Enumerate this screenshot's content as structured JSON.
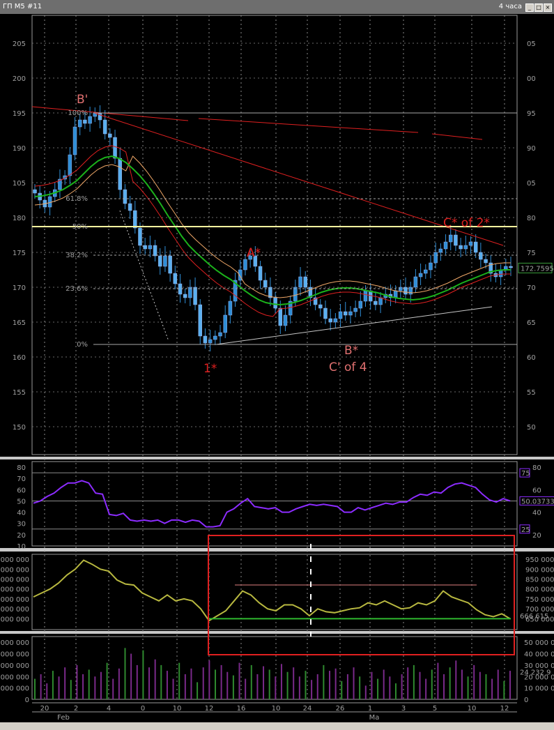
{
  "window": {
    "title": "ГП М5 #11",
    "timeframe": "4 часа",
    "buttons": [
      "_",
      "□",
      "×"
    ]
  },
  "colors": {
    "background": "#000000",
    "up_candle": "#2f8fd8",
    "down_candle": "#2f8fd8",
    "ma_green": "#1bb21b",
    "ma_red": "#e02020",
    "ma_orange": "#f0a868",
    "trendline": "#e02020",
    "fib_50": "#fff8a0",
    "osc_line": "#8c2cff",
    "volume_line": "#b8b840",
    "highlight_box": "#e02020"
  },
  "chart_data": [
    {
      "type": "candlestick",
      "panel": "price",
      "ylim": [
        146,
        209
      ],
      "left_ticks": [
        150,
        155,
        160,
        165,
        170,
        175,
        180,
        185,
        190,
        195,
        200,
        205
      ],
      "left_tick_labels": [
        "150",
        "155",
        "160",
        "165",
        "170",
        "175",
        "180",
        "105",
        "190",
        "195",
        "200",
        "205"
      ],
      "right_ticks": [
        150,
        155,
        160,
        165,
        170,
        175,
        180,
        185,
        190,
        195,
        200,
        205
      ],
      "right_tick_labels": [
        "50",
        "55",
        "60",
        "65",
        "70",
        "75",
        "80",
        "05",
        "90",
        "95",
        "00",
        "05"
      ],
      "last_price_label": "172.7595",
      "x_labels": [
        "20",
        "Feb",
        "2",
        "4",
        "0",
        "10",
        "12",
        "16",
        "10",
        "24",
        "26",
        "1",
        "Ma",
        "3",
        "5",
        "10",
        "12"
      ],
      "closes": [
        183.5,
        182.5,
        181.5,
        183.0,
        184.0,
        185.5,
        186.0,
        189.0,
        193.0,
        194.0,
        193.5,
        194.5,
        195.0,
        194.0,
        192.0,
        191.5,
        188.5,
        184.0,
        182.0,
        181.0,
        178.5,
        176.0,
        175.5,
        176.0,
        174.5,
        173.0,
        174.5,
        172.0,
        170.5,
        169.0,
        168.5,
        170.0,
        167.5,
        163.0,
        162.0,
        162.5,
        163.0,
        163.5,
        166.0,
        168.0,
        171.0,
        172.5,
        174.0,
        174.5,
        173.0,
        171.0,
        170.0,
        168.5,
        167.0,
        164.5,
        166.0,
        168.0,
        170.0,
        171.5,
        170.0,
        168.5,
        167.5,
        167.0,
        165.5,
        165.0,
        165.5,
        166.5,
        166.0,
        166.5,
        167.0,
        168.0,
        169.5,
        168.0,
        167.5,
        168.5,
        169.0,
        168.5,
        169.5,
        170.0,
        169.0,
        170.0,
        171.5,
        172.0,
        172.5,
        173.5,
        175.0,
        175.5,
        176.5,
        177.5,
        176.0,
        175.5,
        176.0,
        176.5,
        175.0,
        174.0,
        173.5,
        172.0,
        171.5,
        172.5,
        173.0,
        172.8
      ],
      "ma_green": [
        183.0,
        183.1,
        183.3,
        183.6,
        184.0,
        184.6,
        185.3,
        186.3,
        187.3,
        188.1,
        188.6,
        188.8,
        188.5,
        187.9,
        187.0,
        186.0,
        184.8,
        183.4,
        181.9,
        180.3,
        178.8,
        177.3,
        176.0,
        175.0,
        174.1,
        173.2,
        172.4,
        171.7,
        171.1,
        170.3,
        169.5,
        168.8,
        168.2,
        167.8,
        167.6,
        167.5,
        167.6,
        167.8,
        168.1,
        168.5,
        168.9,
        169.3,
        169.6,
        169.8,
        169.9,
        169.9,
        169.8,
        169.6,
        169.4,
        169.2,
        168.9,
        168.6,
        168.4,
        168.3,
        168.2,
        168.3,
        168.5,
        168.8,
        169.2,
        169.6,
        170.1,
        170.6,
        171.0,
        171.4,
        171.8,
        172.2,
        172.4,
        172.5,
        172.5
      ],
      "annotations": [
        {
          "text": "B'",
          "color": "#e07070"
        },
        {
          "text": "A*",
          "color": "#e02020"
        },
        {
          "text": "1*",
          "color": "#e02020"
        },
        {
          "text": "B*",
          "color": "#e07070"
        },
        {
          "text": "C' of 4",
          "color": "#e07070"
        },
        {
          "text": "C* of 2*",
          "color": "#e02020"
        }
      ],
      "fib_levels": [
        {
          "label": "100%",
          "value": 195.0
        },
        {
          "label": "61.8%",
          "value": 182.7
        },
        {
          "label": "50%",
          "value": 178.7
        },
        {
          "label": "38.2%",
          "value": 174.6
        },
        {
          "label": "23.6%",
          "value": 169.8
        },
        {
          "label": "0%",
          "value": 161.8
        }
      ]
    },
    {
      "type": "line",
      "panel": "oscillator",
      "ylim": [
        10,
        85
      ],
      "left_ticks": [
        10,
        20,
        30,
        40,
        50,
        60,
        70,
        80
      ],
      "right_tick_labels": [
        "20",
        "40",
        "60",
        "80"
      ],
      "badges": [
        "75",
        "50.03733",
        "25"
      ],
      "values": [
        48,
        50,
        54,
        57,
        62,
        66,
        66,
        68,
        66,
        57,
        56,
        38,
        37,
        39,
        33,
        32,
        33,
        32,
        33,
        30,
        33,
        33,
        31,
        33,
        32,
        27,
        27,
        28,
        40,
        43,
        48,
        52,
        45,
        44,
        43,
        44,
        40,
        40,
        43,
        45,
        47,
        46,
        47,
        46,
        45,
        40,
        40,
        44,
        42,
        44,
        46,
        48,
        47,
        49,
        49,
        53,
        56,
        55,
        58,
        57,
        62,
        65,
        66,
        64,
        62,
        56,
        51,
        49,
        52,
        50
      ]
    },
    {
      "type": "line",
      "panel": "volume_index",
      "ylim": [
        595000,
        975000
      ],
      "left_tick_labels": [
        "000 000",
        "000 000",
        "000 000",
        "000 000",
        "000 000",
        "000 000",
        "000 000"
      ],
      "right_tick_labels": [
        "950 000",
        "900 000",
        "850 000",
        "800 000",
        "750 000",
        "700 000",
        "650 000"
      ],
      "last_value_label": "666 615",
      "values": [
        760,
        780,
        800,
        830,
        870,
        900,
        945,
        925,
        900,
        890,
        845,
        825,
        820,
        780,
        760,
        740,
        770,
        740,
        750,
        740,
        700,
        640,
        665,
        690,
        740,
        790,
        770,
        730,
        700,
        690,
        720,
        720,
        700,
        665,
        700,
        685,
        680,
        690,
        700,
        705,
        730,
        720,
        740,
        720,
        700,
        705,
        730,
        720,
        740,
        790,
        760,
        745,
        730,
        695,
        670,
        660,
        675,
        650
      ],
      "support_value": 650,
      "resistance_value": 820
    },
    {
      "type": "bar",
      "panel": "volume",
      "ylim": [
        0,
        55000
      ],
      "left_tick_labels": [
        "000 000",
        "000 000",
        "000 000",
        "000 000",
        "000 000",
        "0"
      ],
      "right_tick_labels": [
        "50 000 0",
        "40 000 0",
        "30 000 0",
        "20 000 0",
        "10 000 0",
        "0"
      ],
      "last_value_label": "24 232 9",
      "values": [
        18,
        22,
        14,
        25,
        20,
        28,
        17,
        30,
        22,
        26,
        20,
        24,
        32,
        18,
        27,
        45,
        40,
        30,
        43,
        28,
        35,
        30,
        25,
        18,
        32,
        22,
        27,
        15,
        28,
        34,
        26,
        30,
        24,
        21,
        32,
        18,
        30,
        22,
        29,
        26,
        20,
        31,
        24,
        28,
        20,
        25,
        17,
        22,
        30,
        25,
        27,
        16,
        22,
        28,
        20,
        12,
        24,
        18,
        26,
        20,
        14,
        22,
        28,
        30,
        24,
        18,
        26,
        32,
        22,
        28,
        34,
        26,
        20,
        30,
        24,
        22,
        18,
        26,
        16,
        25
      ]
    }
  ]
}
